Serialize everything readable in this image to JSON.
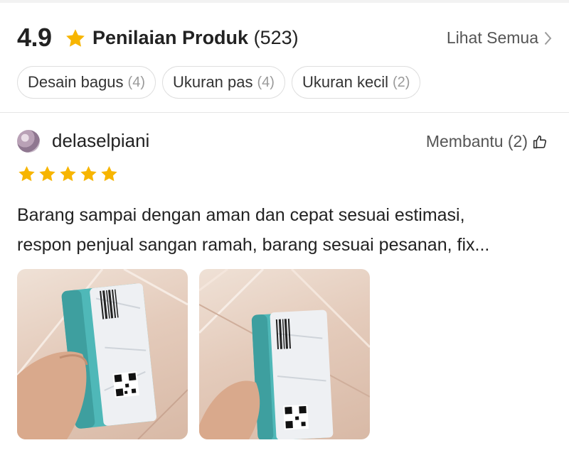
{
  "header": {
    "score": "4.9",
    "title": "Penilaian Produk",
    "count": "(523)",
    "see_all": "Lihat Semua"
  },
  "tags": [
    {
      "label": "Desain bagus",
      "count": "(4)"
    },
    {
      "label": "Ukuran pas",
      "count": "(4)"
    },
    {
      "label": "Ukuran kecil",
      "count": "(2)"
    }
  ],
  "review": {
    "username": "delaselpiani",
    "helpful": "Membantu (2)",
    "stars": 5,
    "text_line1": "Barang sampai dengan aman dan cepat sesuai estimasi,",
    "text_line2": "respon penjual sangan ramah, barang sesuai pesanan, fix..."
  },
  "colors": {
    "star": "#f7b500",
    "text": "#222222",
    "muted": "#9a9a9a",
    "border": "#dedede",
    "package_teal": "#4fb8b8"
  },
  "icons": {
    "rating": "star-icon",
    "see_all": "chevron-right-icon",
    "helpful": "thumbs-up-icon"
  }
}
